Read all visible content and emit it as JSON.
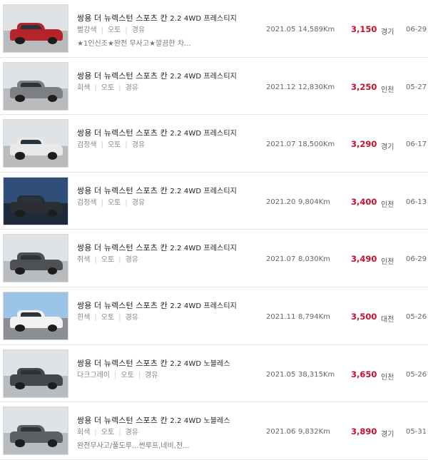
{
  "listings": [
    {
      "title": "쌍용 더 뉴렉스턴 스포츠 칸",
      "trim": "2.2 4WD 프레스티지",
      "color": "빨강색",
      "transmission": "오토",
      "fuel": "경유",
      "note": "★1인신조★완전 무사고★깔끔한 차...",
      "year": "2021.05",
      "km": "14,589Km",
      "price": "3,150",
      "region": "경기",
      "date": "06-29",
      "car_color": "#b5232b",
      "scene": "indoor"
    },
    {
      "title": "쌍용 더 뉴렉스턴 스포츠 칸",
      "trim": "2.2 4WD 프레스티지",
      "color": "회색",
      "transmission": "오토",
      "fuel": "경유",
      "note": "",
      "year": "2021.12",
      "km": "12,830Km",
      "price": "3,250",
      "region": "인천",
      "date": "05-27",
      "car_color": "#7d7f82",
      "scene": "indoor"
    },
    {
      "title": "쌍용 더 뉴렉스턴 스포츠 칸",
      "trim": "2.2 4WD 프레스티지",
      "color": "검정색",
      "transmission": "오토",
      "fuel": "경유",
      "note": "",
      "year": "2021.07",
      "km": "18,500Km",
      "price": "3,290",
      "region": "경기",
      "date": "06-17",
      "car_color": "#e9e9e9",
      "scene": "indoor"
    },
    {
      "title": "쌍용 더 뉴렉스턴 스포츠 칸",
      "trim": "2.2 4WD 프레스티지",
      "color": "검정색",
      "transmission": "오토",
      "fuel": "경유",
      "note": "",
      "year": "2021.20",
      "km": "9,804Km",
      "price": "3,400",
      "region": "인천",
      "date": "06-13",
      "car_color": "#2a2d31",
      "scene": "studio"
    },
    {
      "title": "쌍용 더 뉴렉스턴 스포츠 칸",
      "trim": "2.2 4WD 프레스티지",
      "color": "쥐색",
      "transmission": "오토",
      "fuel": "경유",
      "note": "",
      "year": "2021.07",
      "km": "8,030Km",
      "price": "3,490",
      "region": "인천",
      "date": "06-29",
      "car_color": "#4e5154",
      "scene": "indoor"
    },
    {
      "title": "쌍용 더 뉴렉스턴 스포츠 칸",
      "trim": "2.2 4WD 프레스티지",
      "color": "흰색",
      "transmission": "오토",
      "fuel": "경유",
      "note": "",
      "year": "2021.11",
      "km": "8,794Km",
      "price": "3,500",
      "region": "대전",
      "date": "05-26",
      "car_color": "#f2f2f2",
      "scene": "outdoor"
    },
    {
      "title": "쌍용 더 뉴렉스턴 스포츠 칸",
      "trim": "2.2 4WD 노블레스",
      "color": "다크그레이",
      "transmission": "오토",
      "fuel": "경유",
      "note": "",
      "year": "2021.05",
      "km": "38,315Km",
      "price": "3,650",
      "region": "인천",
      "date": "05-26",
      "car_color": "#45484b",
      "scene": "indoor"
    },
    {
      "title": "쌍용 더 뉴렉스턴 스포츠 칸",
      "trim": "2.2 4WD 노블레스",
      "color": "회색",
      "transmission": "오토",
      "fuel": "경유",
      "note": "완전무사고/풀도루...썬루프,네비,전...",
      "year": "2021.06",
      "km": "9,832Km",
      "price": "3,890",
      "region": "경기",
      "date": "05-31",
      "car_color": "#5c6064",
      "scene": "indoor"
    }
  ],
  "colors": {
    "price": "#c8102e",
    "border": "#e6e6e6"
  },
  "icons": {
    "thumbnail": "car-photo"
  }
}
